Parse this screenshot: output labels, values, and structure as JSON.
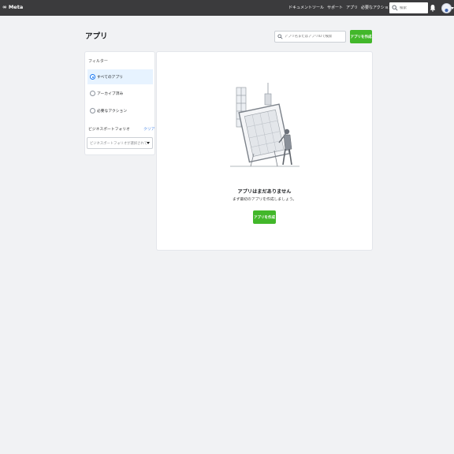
{
  "brand": {
    "logo_text": "Meta"
  },
  "nav": {
    "items": [
      {
        "label": "ドキュメント"
      },
      {
        "label": "ツール"
      },
      {
        "label": "サポート"
      },
      {
        "label": "アプリ"
      },
      {
        "label": "必要なアクション"
      }
    ],
    "search_placeholder": "検索"
  },
  "page": {
    "title": "アプリ",
    "search_placeholder": "アプリ名またはアプリIDで検索",
    "create_button": "アプリを作成"
  },
  "filters": {
    "title": "フィルター",
    "options": [
      {
        "label": "すべてのアプリ",
        "selected": true
      },
      {
        "label": "アーカイブ済み",
        "selected": false
      },
      {
        "label": "必要なアクション",
        "selected": false
      }
    ],
    "business_portfolio_label": "ビジネスポートフォリオ",
    "clear_label": "クリア",
    "business_portfolio_placeholder": "ビジネスポートフォリオが選択されていません"
  },
  "empty_state": {
    "title": "アプリはまだありません",
    "subtitle": "まず最初のアプリを作成しましょう。",
    "create_button": "アプリを作成"
  },
  "colors": {
    "topbar": "#3b3b3d",
    "accent_green": "#42b72a",
    "link_blue": "#4d8be9",
    "selected_bg": "#e7f3ff"
  },
  "icons": [
    "meta-logo-icon",
    "search-icon",
    "bell-icon",
    "avatar-icon",
    "chevron-down-icon",
    "radio-icon",
    "empty-illustration"
  ]
}
